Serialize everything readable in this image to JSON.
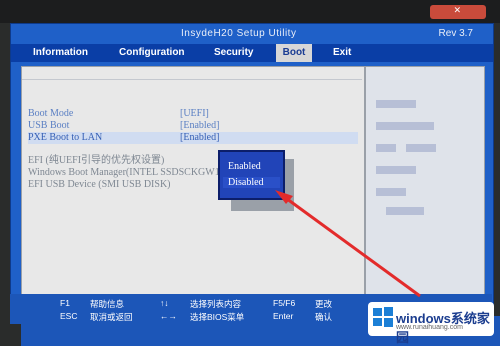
{
  "window": {
    "title": "InsydeH20 Setup Utility",
    "revision": "Rev 3.7",
    "close_glyph": "✕"
  },
  "tabs": [
    {
      "label": "Information"
    },
    {
      "label": "Configuration"
    },
    {
      "label": "Security"
    },
    {
      "label": "Boot",
      "active": true
    },
    {
      "label": "Exit"
    }
  ],
  "settings": [
    {
      "label": "Boot Mode",
      "value": "[UEFI]"
    },
    {
      "label": "USB Boot",
      "value": "[Enabled]"
    },
    {
      "label": "PXE Boot to LAN",
      "value": "[Enabled]",
      "highlighted": true
    }
  ],
  "efi": {
    "header": "EFI (纯UEFI引导的优先权设置)",
    "entries": [
      "Windows Boot Manager(INTEL SSDSCKGW180A4L)",
      "EFI USB Device (SMI USB DISK)"
    ]
  },
  "popup": {
    "options": [
      "Enabled",
      "Disabled"
    ],
    "selected": "Disabled"
  },
  "footer": {
    "row1": [
      {
        "key": "F1",
        "desc": "帮助信息"
      },
      {
        "key": "↑↓",
        "desc": "选择列表内容"
      },
      {
        "key": "F5/F6",
        "desc": "更改"
      }
    ],
    "row2": [
      {
        "key": "ESC",
        "desc": "取消或返回"
      },
      {
        "key": "←→",
        "desc": "选择BIOS菜单"
      },
      {
        "key": "Enter",
        "desc": "确认"
      }
    ]
  },
  "watermark": {
    "line1": "windows系统家园",
    "line2": "www.runaihuang.com"
  },
  "colors": {
    "frame_blue": "#1f60c8",
    "tab_bar": "#0a3ea6",
    "popup": "#2144b8",
    "arrow": "#e32b2b"
  }
}
